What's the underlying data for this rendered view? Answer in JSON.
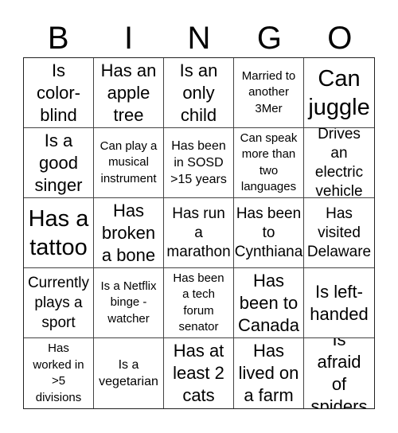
{
  "header": {
    "letters": [
      "B",
      "I",
      "N",
      "G",
      "O"
    ]
  },
  "board": {
    "rows": [
      [
        "Is color-blind",
        "Has an apple tree",
        "Is an only child",
        "Married to another 3Mer",
        "Can juggle"
      ],
      [
        "Is a good singer",
        "Can play a musical instrument",
        "Has been in SOSD >15 years",
        "Can speak more than two languages",
        "Drives an electric vehicle"
      ],
      [
        "Has a tattoo",
        "Has broken a bone",
        "Has run a marathon",
        "Has been to Cynthiana",
        "Has visited Delaware"
      ],
      [
        "Currently plays a sport",
        "Is a Netflix binge - watcher",
        "Has been a tech forum senator",
        "Has been to Canada",
        "Is left-handed"
      ],
      [
        "Has worked in >5 divisions",
        "Is a vegetarian",
        "Has at least 2 cats",
        "Has lived on a farm",
        "Is afraid of spiders"
      ]
    ]
  }
}
